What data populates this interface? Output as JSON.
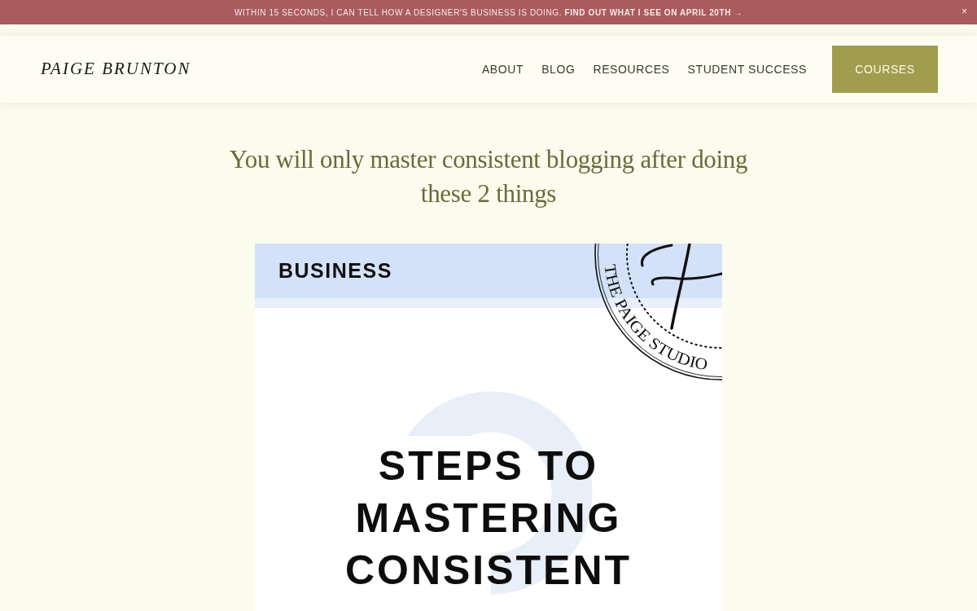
{
  "announcement": {
    "text": "WITHIN 15 SECONDS, I CAN TELL HOW A DESIGNER'S BUSINESS IS DOING. **FIND OUT WHAT I SEE ON APRIL 20TH →**",
    "close": "×"
  },
  "header": {
    "logo": "PAIGE BRUNTON",
    "nav": [
      {
        "label": "ABOUT",
        "kind": "link"
      },
      {
        "label": "BLOG",
        "kind": "link"
      },
      {
        "label": "RESOURCES",
        "kind": "link"
      },
      {
        "label": "STUDENT SUCCESS",
        "kind": "link"
      },
      {
        "label": "COURSES",
        "kind": "button"
      }
    ]
  },
  "post": {
    "title": "You will only master consistent blogging after doing these 2 things",
    "featured_graphic": {
      "category": "BUSINESS",
      "stamp": "THE PAIGE STUDIO",
      "headline": "STEPS TO MASTERING CONSISTENT"
    }
  }
}
